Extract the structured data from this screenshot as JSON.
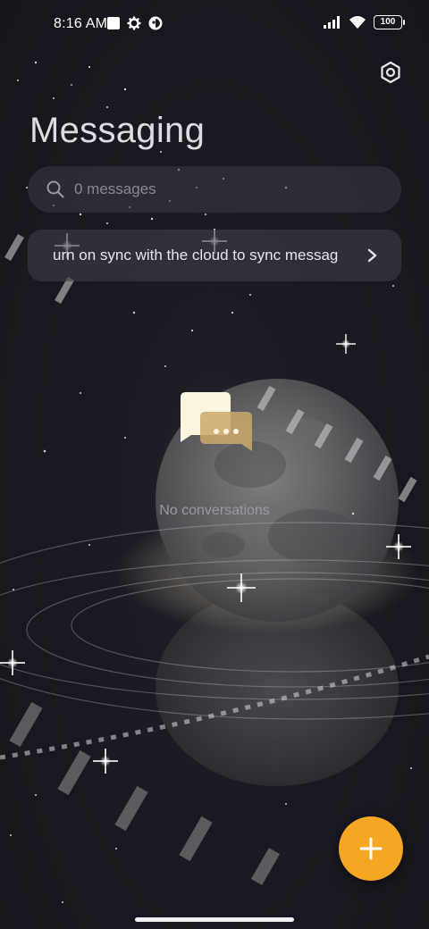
{
  "status_bar": {
    "time": "8:16 AM",
    "battery": "100",
    "left_icons": [
      "square-notification-icon",
      "gear-icon",
      "app-notification-icon"
    ],
    "right_icons": [
      "signal-icon",
      "wifi-icon",
      "battery-icon"
    ]
  },
  "header": {
    "title": "Messaging",
    "settings_icon": "settings-icon"
  },
  "search": {
    "placeholder": "0 messages",
    "icon": "search-icon"
  },
  "sync_banner": {
    "text": "urn on sync with the cloud to sync messag",
    "icon": "chevron-right-icon"
  },
  "empty_state": {
    "text": "No conversations",
    "icon": "chat-bubbles-icon"
  },
  "fab": {
    "icon": "plus-icon",
    "color": "#f5a623"
  },
  "colors": {
    "background": "#17171f",
    "accent": "#f5a623"
  }
}
